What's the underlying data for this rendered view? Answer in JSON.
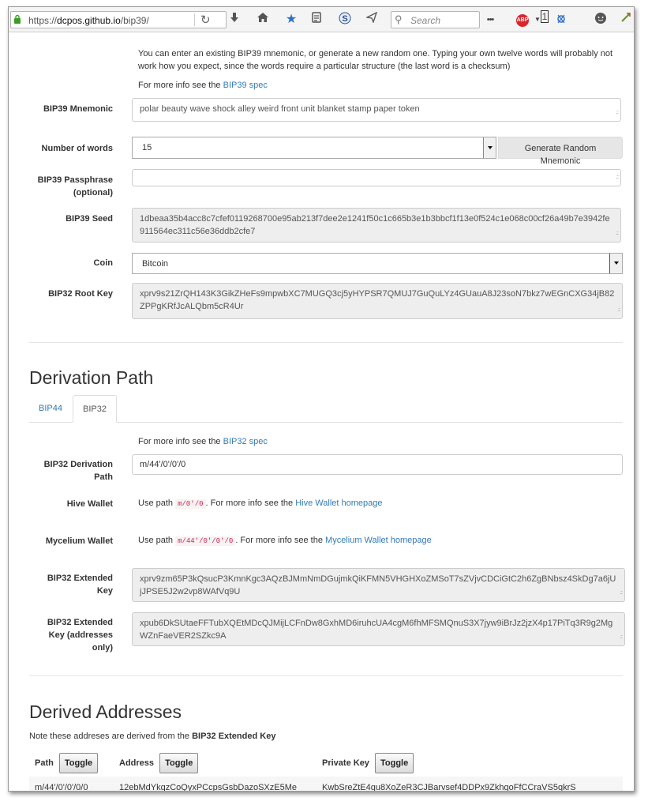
{
  "browser": {
    "url_prefix": "https://",
    "url_host": "dcpos.github.io",
    "url_path": "/bip39/",
    "search_placeholder": "Search",
    "abp_label": "ABP",
    "toolbar_badge": "1"
  },
  "mnemonic": {
    "intro": "You can enter an existing BIP39 mnemonic, or generate a new random one. Typing your own twelve words will probably not work how you expect, since the words require a particular structure (the last word is a checksum)",
    "more_info_prefix": "For more info see the ",
    "more_info_link": "BIP39 spec",
    "mnemonic_label": "BIP39 Mnemonic",
    "mnemonic_value": "polar beauty wave shock alley weird front unit blanket stamp paper token",
    "num_words_label": "Number of words",
    "num_words_value": "15",
    "generate_label": "Generate Random Mnemonic",
    "passphrase_label_1": "BIP39 Passphrase",
    "passphrase_label_2": "(optional)",
    "passphrase_value": "",
    "seed_label": "BIP39 Seed",
    "seed_value": "1dbeaa35b4acc8c7cfef0119268700e95ab213f7dee2e1241f50c1c665b3e1b3bbcf1f13e0f524c1e068c00cf26a49b7e3942fe911564ec311c56e36ddb2cfe7",
    "coin_label": "Coin",
    "coin_value": "Bitcoin",
    "root_key_label": "BIP32 Root Key",
    "root_key_value": "xprv9s21ZrQH143K3GikZHeFs9mpwbXC7MUGQ3cj5yHYPSR7QMUJ7GuQuLYz4GUauA8J23soN7bkz7wEGnCXG34jB82ZPPgKRfJcALQbm5cR4Ur"
  },
  "derivation": {
    "heading": "Derivation Path",
    "tabs": [
      "BIP44",
      "BIP32"
    ],
    "more_info_prefix": "For more info see the ",
    "more_info_link": "BIP32 spec",
    "path_label_1": "BIP32 Derivation",
    "path_label_2": "Path",
    "path_value": "m/44'/0'/0'/0",
    "hive_label": "Hive Wallet",
    "hive_prefix": "Use path ",
    "hive_code": "m/0'/0",
    "hive_mid": ". For more info see the ",
    "hive_link": "Hive Wallet homepage",
    "mycelium_label": "Mycelium Wallet",
    "mycelium_prefix": "Use path ",
    "mycelium_code": "m/44'/0'/0'/0",
    "mycelium_mid": ". For more info see the ",
    "mycelium_link": "Mycelium Wallet homepage",
    "ext_key_label_1": "BIP32 Extended",
    "ext_key_label_2": "Key",
    "ext_key_value": "xprv9zm65P3kQsucP3KmnKgc3AQzBJMmNmDGujmkQiKFMN5VHGHXoZMSoT7sZVjvCDCiGtC2h6ZgBNbsz4SkDg7a6jUjJPSE5J2w2vp8WAfVq9U",
    "ext_pub_label_1": "BIP32 Extended",
    "ext_pub_label_2": "Key (addresses",
    "ext_pub_label_3": "only)",
    "ext_pub_value": "xpub6DkSUtaeFFTubXQEtMDcQJMijLCFnDw8GxhMD6iruhcUA4cgM6fhMFSMQnuS3X7jyw9iBrJz2jzX4p17PiTq3R9g2MgWZnFaeVER2SZkc9A"
  },
  "addresses": {
    "heading": "Derived Addresses",
    "note_prefix": "Note these addreses are derived from the ",
    "note_bold": "BIP32 Extended Key",
    "col_path": "Path",
    "col_address": "Address",
    "col_privkey": "Private Key",
    "toggle_label": "Toggle",
    "rows": [
      {
        "path": "m/44'/0'/0'/0/0",
        "address": "12ebMdYkqzCoQyxPCcpsGsbDazoSXzE5Me",
        "privkey": "KwbSreZtE4qu8XoZeR3CJBarvsef4DDPx9ZkhgoFfCCraVS5qkrS"
      }
    ]
  }
}
